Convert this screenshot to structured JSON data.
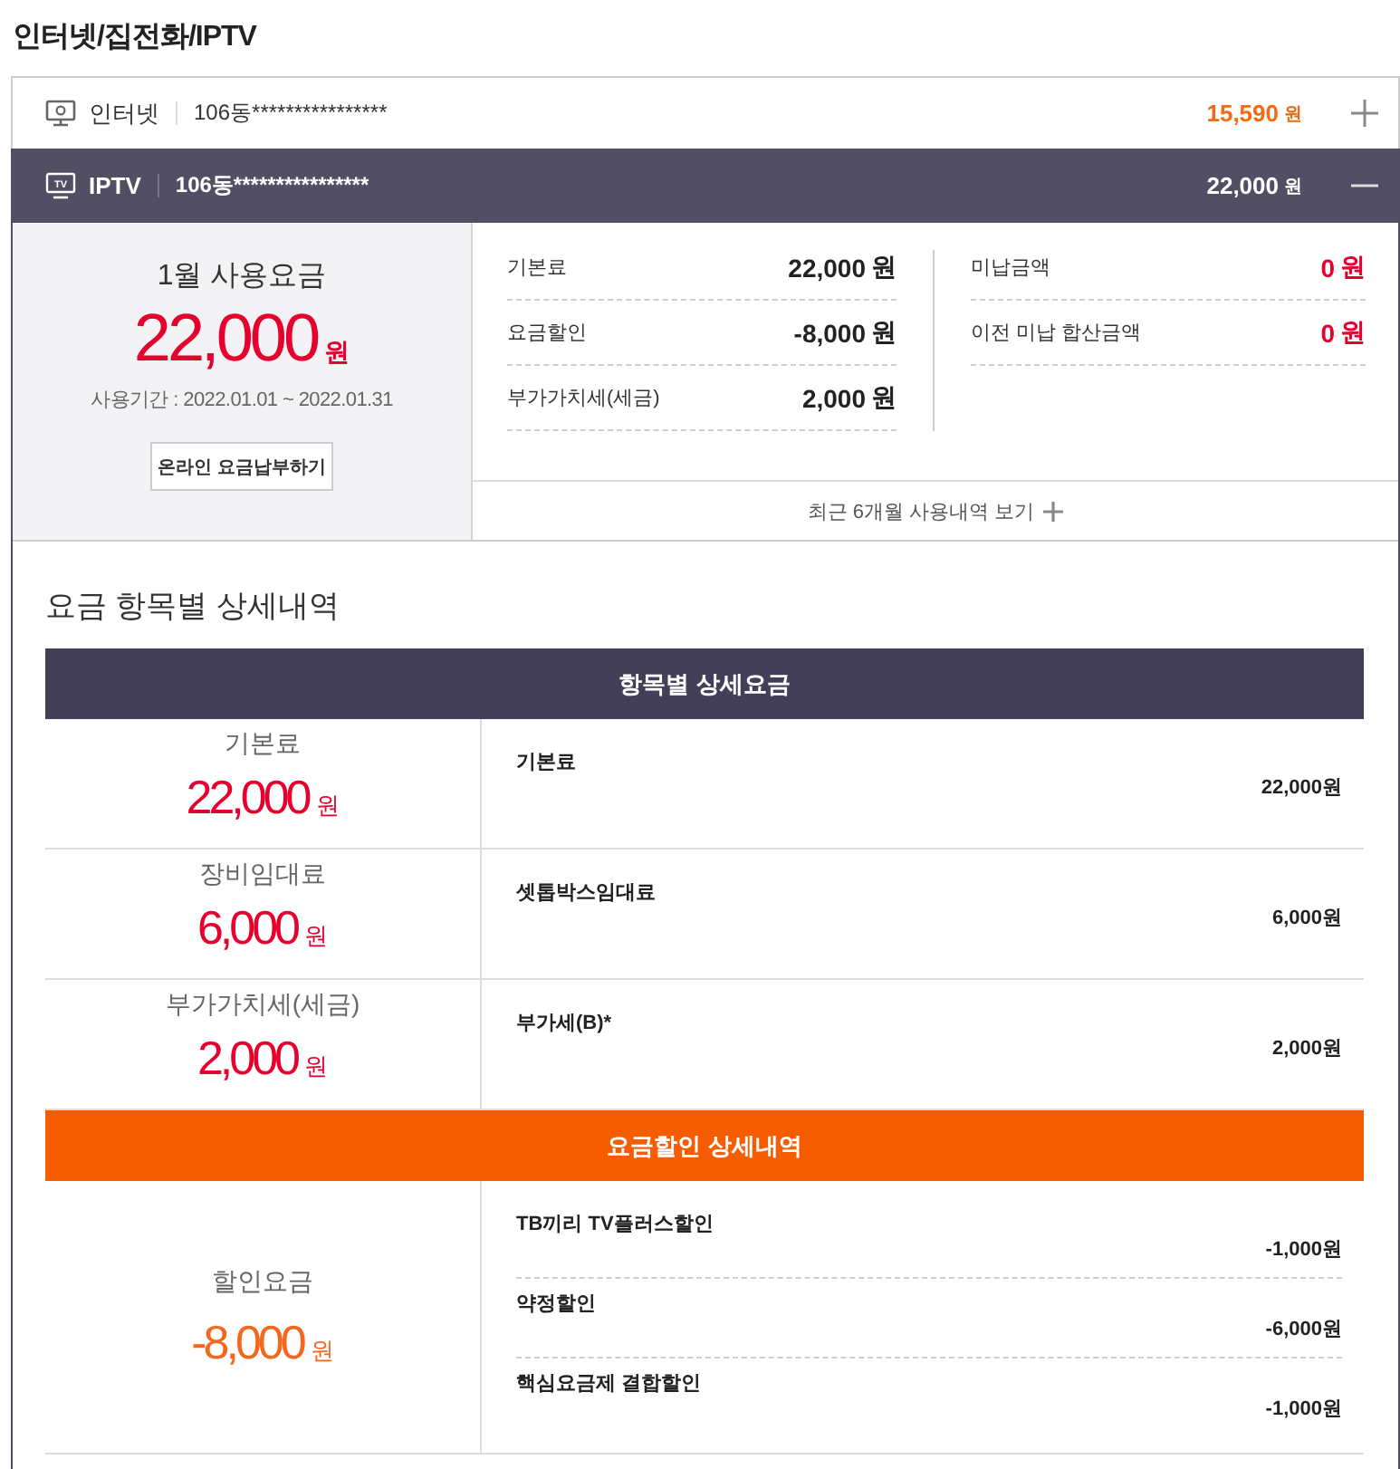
{
  "page_title": "인터넷/집전화/IPTV",
  "services": [
    {
      "kind": "internet",
      "name": "인터넷",
      "address": "106동****************",
      "amount": "15,590",
      "unit": "원",
      "expanded": false
    },
    {
      "kind": "iptv",
      "icon_label": "TV",
      "name": "IPTV",
      "address": "106동****************",
      "amount": "22,000",
      "unit": "원",
      "expanded": true,
      "bill": {
        "title": "1월 사용요금",
        "total": "22,000",
        "unit": "원",
        "period": "사용기간 : 2022.01.01 ~ 2022.01.31",
        "pay_button": "온라인 요금납부하기",
        "charges": [
          {
            "label": "기본료",
            "amount": "22,000",
            "unit": "원"
          },
          {
            "label": "요금할인",
            "amount": "-8,000",
            "unit": "원"
          },
          {
            "label": "부가가치세(세금)",
            "amount": "2,000",
            "unit": "원"
          }
        ],
        "arrears": [
          {
            "label": "미납금액",
            "amount": "0",
            "unit": "원"
          },
          {
            "label": "이전 미납 합산금액",
            "amount": "0",
            "unit": "원"
          }
        ],
        "history_link": "최근 6개월 사용내역 보기"
      },
      "detail": {
        "title": "요금 항목별 상세내역",
        "sections": [
          {
            "kind": "charges",
            "header": "항목별 상세요금",
            "rows": [
              {
                "label": "기본료",
                "amount": "22,000",
                "unit": "원",
                "items": [
                  {
                    "name": "기본료",
                    "amount": "22,000원"
                  }
                ]
              },
              {
                "label": "장비임대료",
                "amount": "6,000",
                "unit": "원",
                "items": [
                  {
                    "name": "셋톱박스임대료",
                    "amount": "6,000원"
                  }
                ]
              },
              {
                "label": "부가가치세(세금)",
                "amount": "2,000",
                "unit": "원",
                "items": [
                  {
                    "name": "부가세(B)*",
                    "amount": "2,000원"
                  }
                ]
              }
            ]
          },
          {
            "kind": "discounts",
            "header": "요금할인 상세내역",
            "rows": [
              {
                "label": "할인요금",
                "amount": "-8,000",
                "unit": "원",
                "items": [
                  {
                    "name": "TB끼리 TV플러스할인",
                    "amount": "-1,000원"
                  },
                  {
                    "name": "약정할인",
                    "amount": "-6,000원"
                  },
                  {
                    "name": "핵심요금제 결합할인",
                    "amount": "-1,000원"
                  }
                ]
              }
            ]
          }
        ]
      }
    }
  ]
}
